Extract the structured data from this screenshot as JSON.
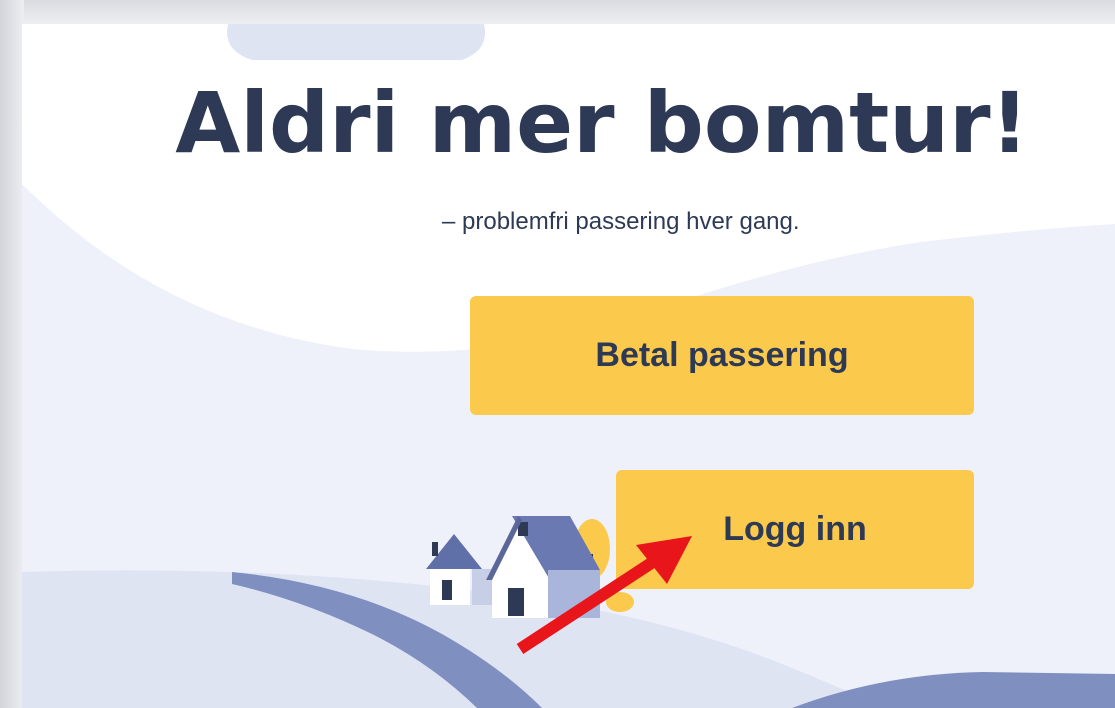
{
  "hero": {
    "headline": "Aldri mer bomtur!",
    "subline": "– problemfri passering hver gang."
  },
  "actions": {
    "pay_label": "Betal passering",
    "login_label": "Logg inn"
  },
  "colors": {
    "headline": "#2e3a55",
    "button": "#fbc94b",
    "background_light": "#eef0fa",
    "road": "#7f8fc0",
    "hill": "#dfe4f3",
    "annotation_arrow": "#e8161b"
  },
  "icons": {
    "houses": "houses-illustration",
    "annotation": "red-arrow-icon"
  }
}
